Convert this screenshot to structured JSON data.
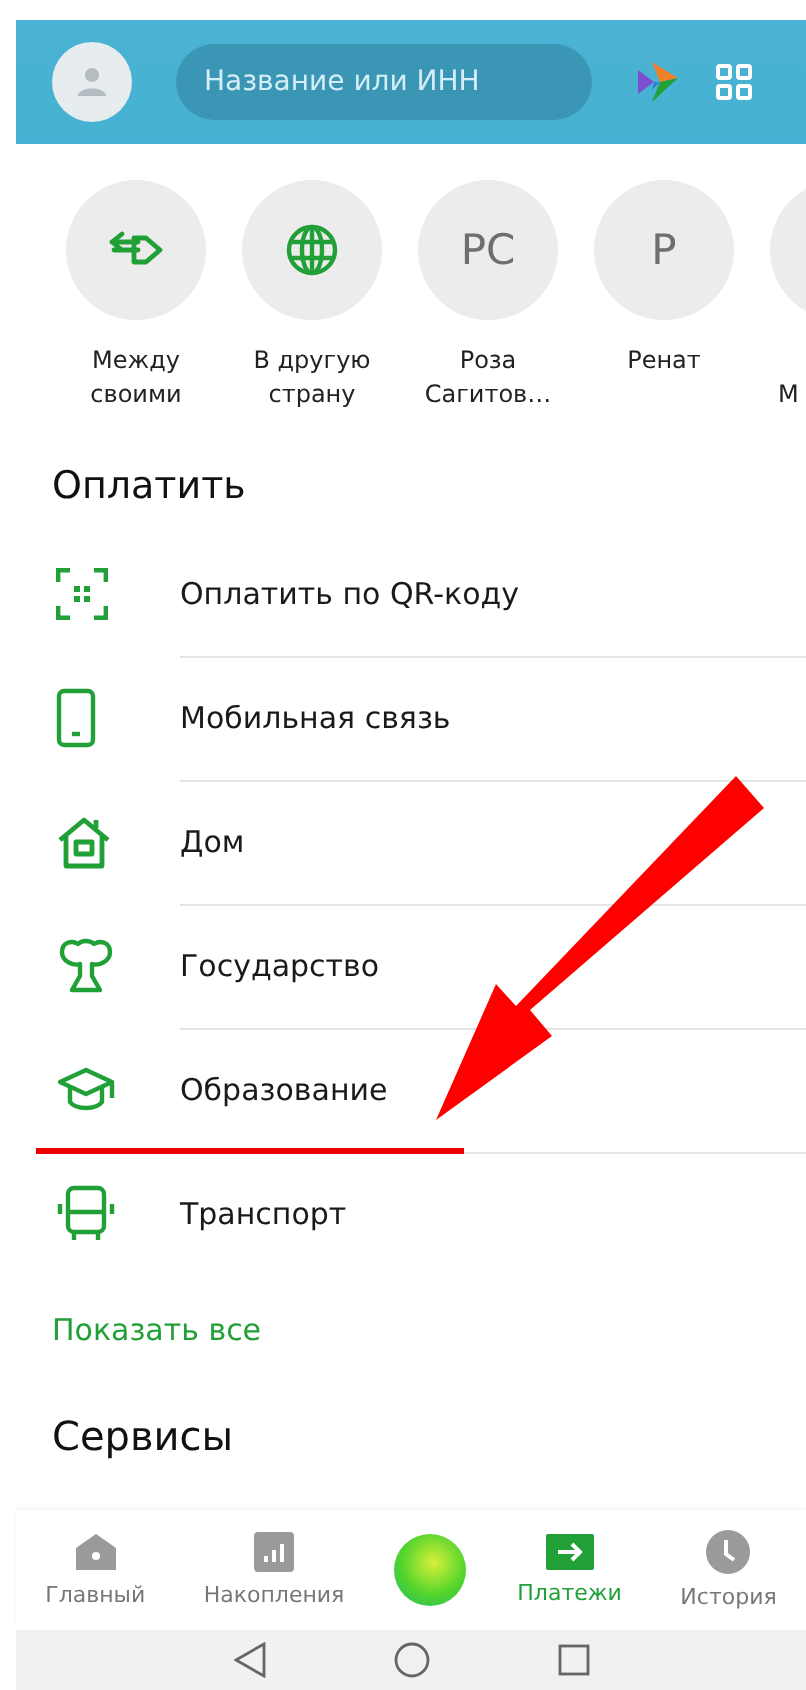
{
  "header": {
    "search": {
      "placeholder": "Название или ИНН"
    }
  },
  "quick_transfers": [
    {
      "kind": "arrows",
      "label": "Между своими"
    },
    {
      "kind": "globe",
      "label": "В другую страну"
    },
    {
      "kind": "initials",
      "initials": "РС",
      "label": "Роза Сагитов…"
    },
    {
      "kind": "initials",
      "initials": "Р",
      "label": "Ренат"
    },
    {
      "kind": "initials",
      "label": "М"
    }
  ],
  "pay": {
    "title": "Оплатить",
    "items": [
      {
        "kind": "qr",
        "label": "Оплатить по QR-коду"
      },
      {
        "kind": "phone",
        "label": "Мобильная связь"
      },
      {
        "kind": "house",
        "label": "Дом"
      },
      {
        "kind": "emblem",
        "label": "Государство"
      },
      {
        "kind": "cap",
        "label": "Образование"
      },
      {
        "kind": "bus",
        "label": "Транспорт"
      }
    ],
    "show_all": "Показать все"
  },
  "services": {
    "title": "Сервисы"
  },
  "bottom_nav": [
    {
      "kind": "home",
      "label": "Главный",
      "selected": false
    },
    {
      "kind": "savings",
      "label": "Накопления",
      "selected": false
    },
    {
      "kind": "payments",
      "label": "Платежи",
      "selected": true
    },
    {
      "kind": "history",
      "label": "История",
      "selected": false
    }
  ]
}
